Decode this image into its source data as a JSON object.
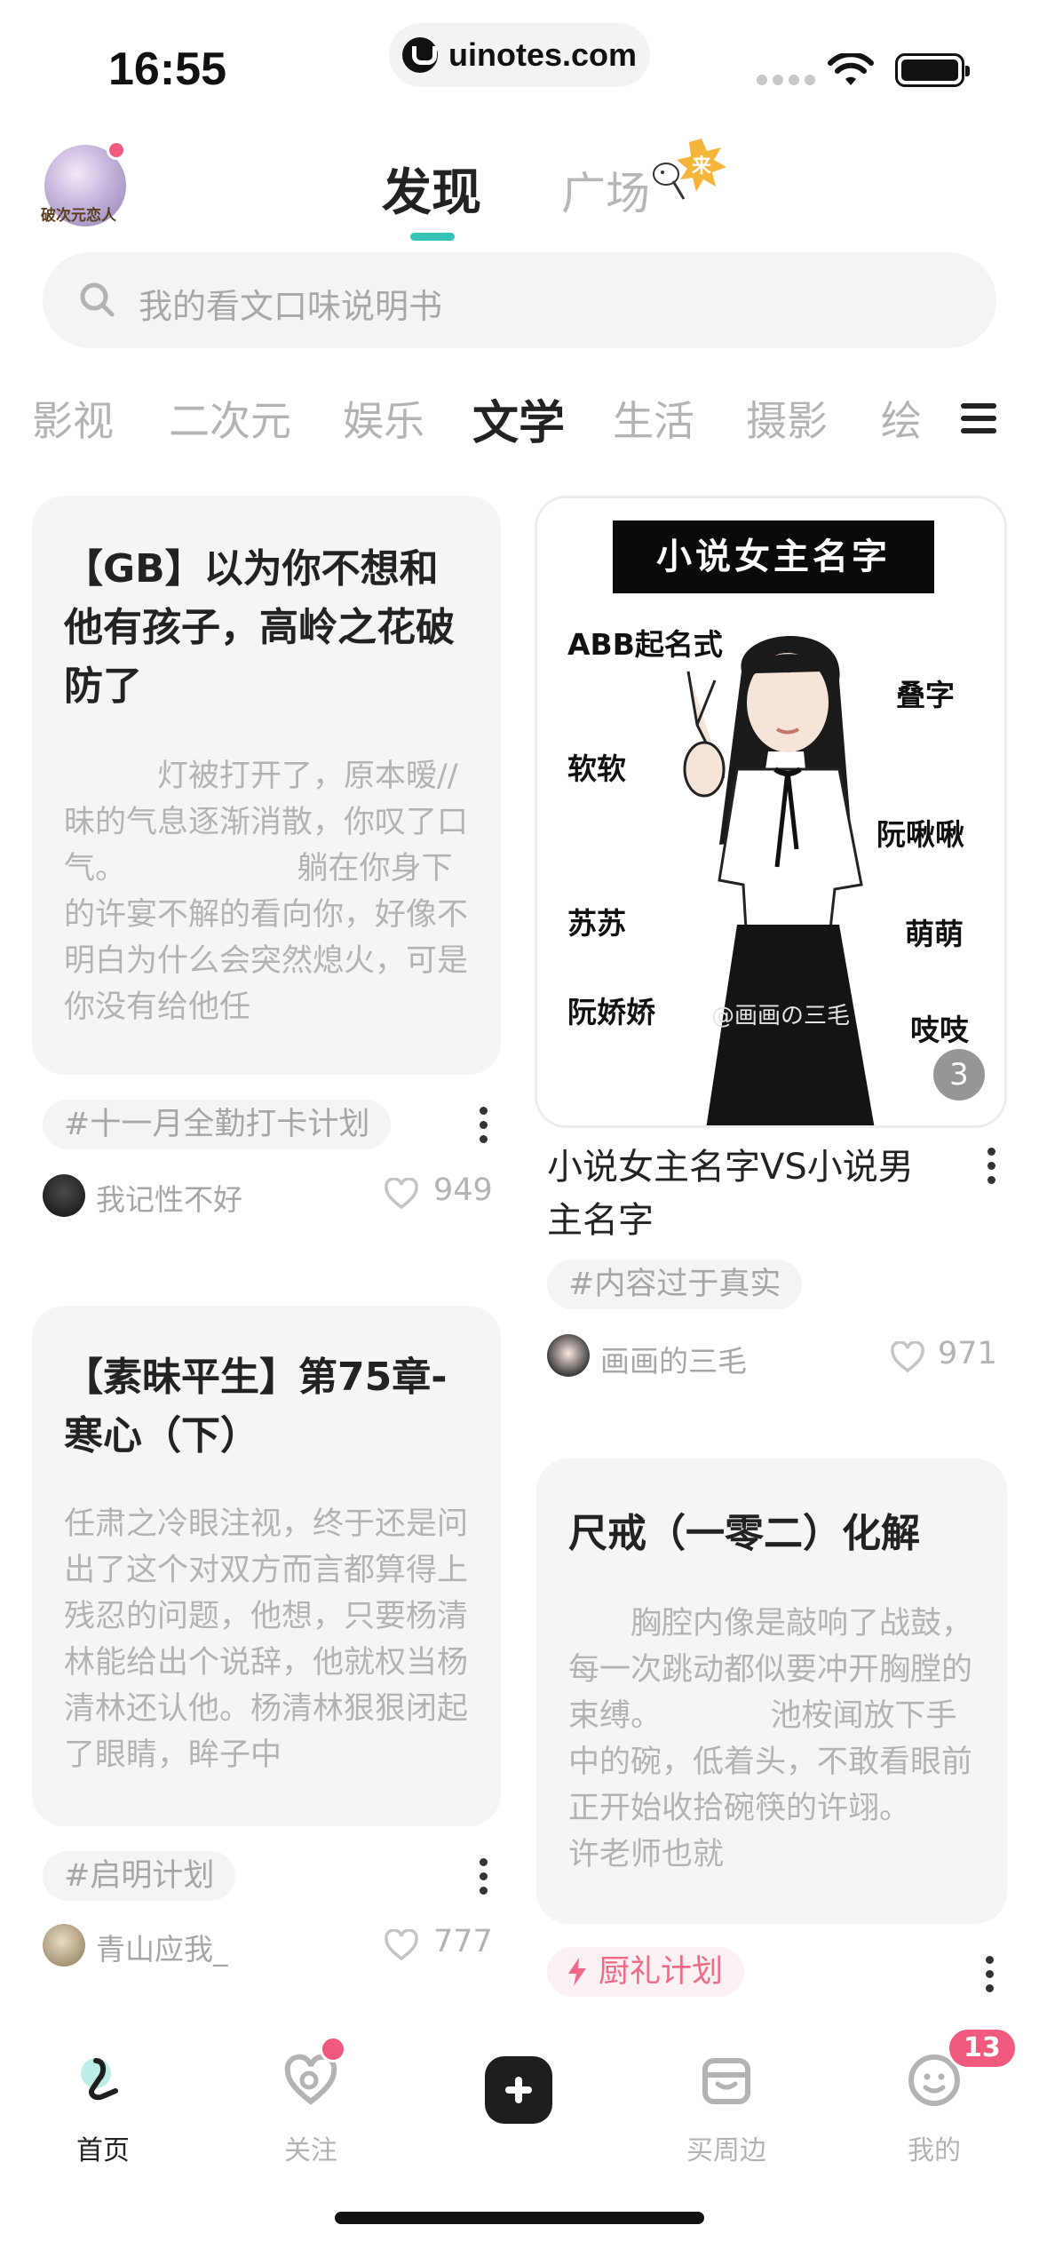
{
  "status_bar": {
    "time": "16:55",
    "url": "uinotes.com"
  },
  "header": {
    "avatar_caption": "破次元恋人",
    "tabs": [
      {
        "label": "发现",
        "active": true
      },
      {
        "label": "广场",
        "active": false
      }
    ],
    "square_badge": "来"
  },
  "search": {
    "placeholder": "我的看文口味说明书"
  },
  "categories": [
    {
      "label": "影视",
      "active": false
    },
    {
      "label": "二次元",
      "active": false
    },
    {
      "label": "娱乐",
      "active": false
    },
    {
      "label": "文学",
      "active": true
    },
    {
      "label": "生活",
      "active": false
    },
    {
      "label": "摄影",
      "active": false
    },
    {
      "label": "绘",
      "active": false
    }
  ],
  "feed": {
    "left": [
      {
        "title": "【GB】以为你不想和他有孩子，高岭之花破防了",
        "body": "　　　灯被打开了，原本暧//昧的气息逐渐消散，你叹了口气。　　　　　　躺在你身下的许宴不解的看向你，好像不明白为什么会突然熄火，可是你没有给他任",
        "tag": "#十一月全勤打卡计划",
        "author": "我记性不好",
        "likes": "949"
      },
      {
        "title": "【素昧平生】第75章-寒心（下）",
        "body": "任肃之冷眼注视，终于还是问出了这个对双方而言都算得上残忍的问题，他想，只要杨清林能给出个说辞，他就权当杨清林还认他。杨清林狠狠闭起了眼睛，眸子中",
        "tag": "#启明计划",
        "author": "青山应我_",
        "likes": "777"
      }
    ],
    "right": [
      {
        "image": {
          "banner": "小说女主名字",
          "labels": [
            "ABB起名式",
            "叠字",
            "软软",
            "阮啾啾",
            "苏苏",
            "萌萌",
            "阮娇娇",
            "吱吱"
          ],
          "watermark": "@画画の三毛",
          "count": "3"
        },
        "title": "小说女主名字VS小说男主名字",
        "tag": "#内容过于真实",
        "author": "画画的三毛",
        "likes": "971"
      },
      {
        "title": "尺戒（一零二）化解",
        "body": "　　胸腔内像是敲响了战鼓，每一次跳动都似要冲开胸膛的束缚。　　　　池桉闻放下手中的碗，低着头，不敢看眼前正开始收拾碗筷的许翊。　　　许老师也就",
        "tag": "厨礼计划"
      }
    ]
  },
  "bottom_nav": {
    "items": [
      {
        "label": "首页",
        "active": true
      },
      {
        "label": "关注",
        "active": false
      },
      {
        "label": "买周边",
        "active": false
      },
      {
        "label": "我的",
        "active": false
      }
    ],
    "message_badge": "13"
  },
  "colors": {
    "accent": "#37c4b8",
    "badge": "#f05a7e",
    "tag_pink": "#ef6a86"
  }
}
